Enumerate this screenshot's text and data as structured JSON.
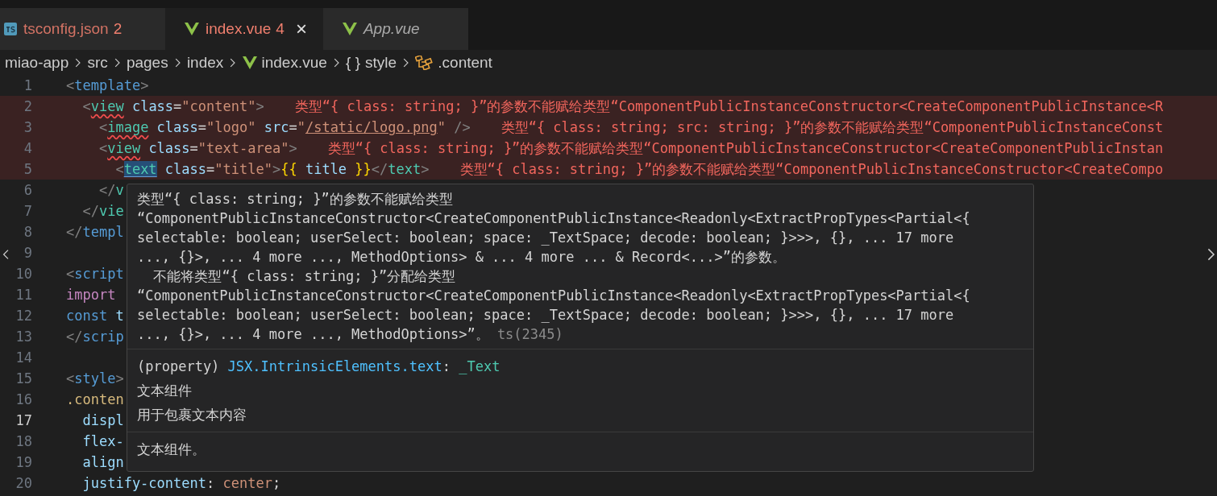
{
  "tabs": [
    {
      "label": "tsconfig.json",
      "kind": "ts",
      "badge": "2",
      "has_errors": true,
      "preview": false,
      "selected": false
    },
    {
      "label": "index.vue",
      "kind": "vue",
      "badge": "4",
      "close": "×",
      "has_errors": true,
      "preview": false,
      "selected": true
    },
    {
      "label": "App.vue",
      "kind": "vue",
      "has_errors": false,
      "preview": true,
      "selected": false
    }
  ],
  "breadcrumb": [
    {
      "label": "miao-app",
      "kind": "folder"
    },
    {
      "label": "src",
      "kind": "folder"
    },
    {
      "label": "pages",
      "kind": "folder"
    },
    {
      "label": "index",
      "kind": "folder"
    },
    {
      "label": "index.vue",
      "kind": "vue"
    },
    {
      "label": "style",
      "kind": "braces",
      "glyph": "{ }"
    },
    {
      "label": ".content",
      "kind": "symbol"
    }
  ],
  "editor": {
    "lines": [
      {
        "number": "1",
        "current": false,
        "tokens": [
          {
            "t": "<",
            "kind": "punct"
          },
          {
            "t": "template",
            "kind": "tag"
          },
          {
            "t": ">",
            "kind": "punct"
          }
        ]
      },
      {
        "number": "2",
        "current": false,
        "error": "类型“{ class: string; }”的参数不能赋给类型“ComponentPublicInstanceConstructor<CreateComponentPublicInstance<R",
        "tokens": [
          {
            "t": "  <",
            "kind": "punct"
          },
          {
            "t": "view",
            "kind": "comp-err"
          },
          {
            "t": " class",
            "kind": "attr"
          },
          {
            "t": "=",
            "kind": "plain"
          },
          {
            "t": "\"content\"",
            "kind": "str"
          },
          {
            "t": ">",
            "kind": "punct"
          }
        ]
      },
      {
        "number": "3",
        "current": false,
        "error": "类型“{ class: string; src: string; }”的参数不能赋给类型“ComponentPublicInstanceConst",
        "tokens": [
          {
            "t": "    <",
            "kind": "punct"
          },
          {
            "t": "image",
            "kind": "comp-err"
          },
          {
            "t": " class",
            "kind": "attr"
          },
          {
            "t": "=",
            "kind": "plain"
          },
          {
            "t": "\"logo\"",
            "kind": "str"
          },
          {
            "t": " src",
            "kind": "attr"
          },
          {
            "t": "=",
            "kind": "plain"
          },
          {
            "t": "\"",
            "kind": "str"
          },
          {
            "t": "/static/logo.png",
            "kind": "path"
          },
          {
            "t": "\"",
            "kind": "str"
          },
          {
            "t": " />",
            "kind": "punct"
          }
        ]
      },
      {
        "number": "4",
        "current": false,
        "error": "类型“{ class: string; }”的参数不能赋给类型“ComponentPublicInstanceConstructor<CreateComponentPublicInstan",
        "tokens": [
          {
            "t": "    <",
            "kind": "punct"
          },
          {
            "t": "view",
            "kind": "comp-err"
          },
          {
            "t": " class",
            "kind": "attr"
          },
          {
            "t": "=",
            "kind": "plain"
          },
          {
            "t": "\"text-area\"",
            "kind": "str"
          },
          {
            "t": ">",
            "kind": "punct"
          }
        ]
      },
      {
        "number": "5",
        "current": false,
        "error": "类型“{ class: string; }”的参数不能赋给类型“ComponentPublicInstanceConstructor<CreateCompo",
        "tokens": [
          {
            "t": "      <",
            "kind": "punct"
          },
          {
            "t": "text",
            "kind": "comp-hover"
          },
          {
            "t": " class",
            "kind": "attr"
          },
          {
            "t": "=",
            "kind": "plain"
          },
          {
            "t": "\"title\"",
            "kind": "str"
          },
          {
            "t": ">",
            "kind": "punct"
          },
          {
            "t": "{{",
            "kind": "brace"
          },
          {
            "t": " title ",
            "kind": "var"
          },
          {
            "t": "}}",
            "kind": "brace"
          },
          {
            "t": "</",
            "kind": "punct"
          },
          {
            "t": "text",
            "kind": "comp"
          },
          {
            "t": ">",
            "kind": "punct"
          }
        ]
      },
      {
        "number": "6",
        "current": false,
        "tokens": [
          {
            "t": "    </",
            "kind": "punct"
          },
          {
            "t": "v",
            "kind": "comp"
          }
        ]
      },
      {
        "number": "7",
        "current": false,
        "tokens": [
          {
            "t": "  </",
            "kind": "punct"
          },
          {
            "t": "vie",
            "kind": "comp"
          }
        ]
      },
      {
        "number": "8",
        "current": false,
        "tokens": [
          {
            "t": "</",
            "kind": "punct"
          },
          {
            "t": "templ",
            "kind": "tag"
          }
        ]
      },
      {
        "number": "9",
        "current": false
      },
      {
        "number": "10",
        "current": false,
        "tokens": [
          {
            "t": "<",
            "kind": "punct"
          },
          {
            "t": "script",
            "kind": "tag"
          }
        ]
      },
      {
        "number": "11",
        "current": false,
        "tokens": [
          {
            "t": "import",
            "kind": "ctl"
          }
        ]
      },
      {
        "number": "12",
        "current": false,
        "tokens": [
          {
            "t": "const",
            "kind": "tag"
          },
          {
            "t": " t",
            "kind": "var"
          }
        ]
      },
      {
        "number": "13",
        "current": false,
        "tokens": [
          {
            "t": "</",
            "kind": "punct"
          },
          {
            "t": "scrip",
            "kind": "tag"
          }
        ]
      },
      {
        "number": "14",
        "current": false
      },
      {
        "number": "15",
        "current": false,
        "tokens": [
          {
            "t": "<",
            "kind": "punct"
          },
          {
            "t": "style",
            "kind": "tag"
          },
          {
            "t": ">",
            "kind": "punct"
          }
        ]
      },
      {
        "number": "16",
        "current": false,
        "tokens": [
          {
            "t": ".conten",
            "kind": "sel"
          }
        ]
      },
      {
        "number": "17",
        "current": true,
        "tokens": [
          {
            "t": "  displ",
            "kind": "prop"
          }
        ]
      },
      {
        "number": "18",
        "current": false,
        "tokens": [
          {
            "t": "  flex-",
            "kind": "prop"
          }
        ]
      },
      {
        "number": "19",
        "current": false,
        "tokens": [
          {
            "t": "  align",
            "kind": "prop"
          }
        ]
      },
      {
        "number": "20",
        "current": false,
        "tokens": [
          {
            "t": "  justify-content",
            "kind": "prop"
          },
          {
            "t": ": ",
            "kind": "plain"
          },
          {
            "t": "center",
            "kind": "val"
          },
          {
            "t": ";",
            "kind": "plain"
          }
        ]
      }
    ]
  },
  "hover": {
    "message_lines": [
      "类型“{ class: string; }”的参数不能赋给类型",
      "“ComponentPublicInstanceConstructor<CreateComponentPublicInstance<Readonly<ExtractPropTypes<Partial<{",
      "selectable: boolean; userSelect: boolean; space: _TextSpace; decode: boolean; }>>>, {}, ... 17 more",
      "..., {}>, ... 4 more ..., MethodOptions> & ... 4 more ... & Record<...>”的参数。",
      "  不能将类型“{ class: string; }”分配给类型",
      "“ComponentPublicInstanceConstructor<CreateComponentPublicInstance<Readonly<ExtractPropTypes<Partial<{",
      "selectable: boolean; userSelect: boolean; space: _TextSpace; decode: boolean; }>>>, {}, ... 17 more",
      "..., {}>, ... 4 more ..., MethodOptions>”。"
    ],
    "source": "ts(2345)",
    "signature": [
      {
        "t": "(property) ",
        "kind": "plain"
      },
      {
        "t": "JSX.IntrinsicElements.text",
        "kind": "name"
      },
      {
        "t": ": ",
        "kind": "plain"
      },
      {
        "t": "_Text",
        "kind": "type"
      }
    ],
    "docs": [
      "文本组件",
      "用于包裹文本内容"
    ],
    "footer": "文本组件。"
  }
}
